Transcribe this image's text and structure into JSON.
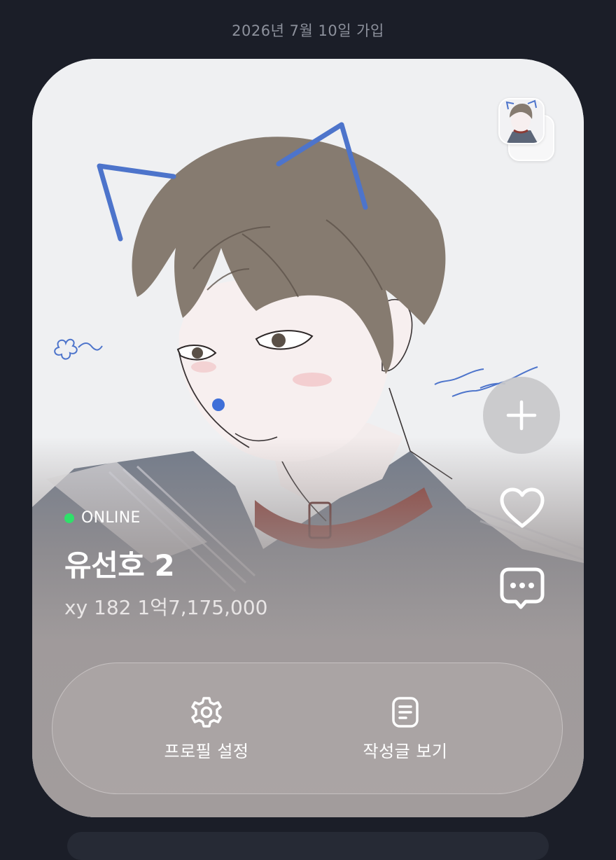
{
  "header": {
    "join_date": "2026년 7월 10일 가입"
  },
  "profile": {
    "status": "ONLINE",
    "status_color": "#2fe06a",
    "name": "유선호 2",
    "info": "xy 182 1억7,175,000",
    "image": "illustrated-portrait-cat-ears",
    "thumbnail": "illustrated-portrait-thumbnail"
  },
  "side_actions": [
    {
      "icon": "plus-icon"
    },
    {
      "icon": "heart-icon"
    },
    {
      "icon": "chat-bubble-icon"
    }
  ],
  "actions": {
    "settings_label": "프로필 설정",
    "settings_icon": "gear-icon",
    "posts_label": "작성글 보기",
    "posts_icon": "document-icon"
  },
  "colors": {
    "background": "#1b1e28",
    "card_bottom": "#a29c9c"
  }
}
